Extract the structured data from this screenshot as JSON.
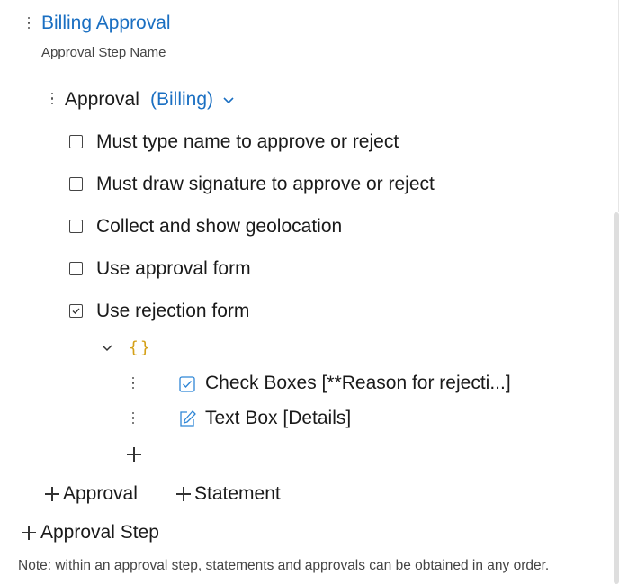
{
  "step": {
    "title": "Billing Approval",
    "caption": "Approval Step Name"
  },
  "approval": {
    "label": "Approval",
    "role": "(Billing)",
    "options": [
      {
        "label": "Must type name to approve or reject",
        "checked": false
      },
      {
        "label": "Must draw signature to approve or reject",
        "checked": false
      },
      {
        "label": "Collect and show geolocation",
        "checked": false
      },
      {
        "label": "Use approval form",
        "checked": false
      },
      {
        "label": "Use rejection form",
        "checked": true
      }
    ],
    "form": {
      "braces": "{}",
      "fields": [
        {
          "label": "Check Boxes [**Reason for rejecti...]",
          "icon": "checkbox-icon"
        },
        {
          "label": "Text Box [Details]",
          "icon": "edit-icon"
        }
      ]
    }
  },
  "actions": {
    "add_approval": "Approval",
    "add_statement": "Statement",
    "add_step": "Approval Step"
  },
  "note": "Note: within an approval step, statements and approvals can be obtained in any order.",
  "colors": {
    "accent": "#1a6fc2",
    "braces": "#d4a017"
  }
}
